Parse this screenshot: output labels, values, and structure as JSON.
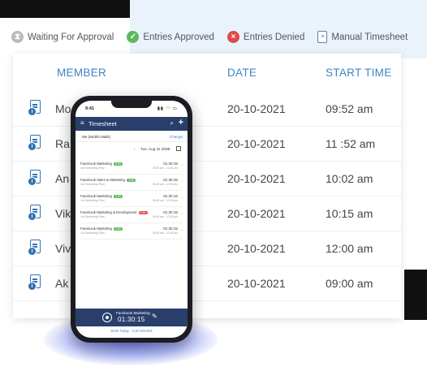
{
  "legend": [
    {
      "label": "Waiting For Approval",
      "icon": "hourglass-icon"
    },
    {
      "label": "Entries Approved",
      "icon": "check-icon"
    },
    {
      "label": "Entries Denied",
      "icon": "x-icon"
    },
    {
      "label": "Manual Timesheet",
      "icon": "document-icon"
    }
  ],
  "table": {
    "headers": {
      "member": "MEMBER",
      "date": "DATE",
      "start": "START TIME"
    },
    "rows": [
      {
        "member": "Mo",
        "date": "20-10-2021",
        "start": "09:52 am"
      },
      {
        "member": "Ra",
        "date": "20-10-2021",
        "start": "11 :52 am"
      },
      {
        "member": "An",
        "date": "20-10-2021",
        "start": "10:02 am"
      },
      {
        "member": "Vik",
        "date": "20-10-2021",
        "start": "10:15 am"
      },
      {
        "member": "Viv",
        "date": "20-10-2021",
        "start": "12:00 am"
      },
      {
        "member": "Ak",
        "date": "20-10-2021",
        "start": "09:00 am"
      }
    ]
  },
  "phone": {
    "status_time": "9:41",
    "app_title": "Timesheet",
    "user_name": "Me (Mobbi Malik)",
    "change_label": "Change",
    "date_label": "Tue, Aug 31 2020",
    "entries": [
      {
        "name": "Facebook Marketing",
        "tag": "4.5h",
        "tag_color": "#5cb85c",
        "sub": "1st Marketing Plan",
        "duration": "01:30:15",
        "range": "09:45 am - 10:30 am"
      },
      {
        "name": "Facebook Sales & Marketing",
        "tag": "4.5h",
        "tag_color": "#5cb85c",
        "sub": "1st Marketing Plan",
        "duration": "01:30:15",
        "range": "09:45 am - 10:30 am"
      },
      {
        "name": "Facebook Marketing",
        "tag": "4.5h",
        "tag_color": "#5cb85c",
        "sub": "1st Marketing Plan",
        "duration": "01:30:15",
        "range": "09:45 am - 10:30 am"
      },
      {
        "name": "Facebook Marketing & Development",
        "tag": "4.5h",
        "tag_color": "#e04b4b",
        "sub": "1st Marketing Plan",
        "duration": "01:30:15",
        "range": "09:45 am - 10:30 am"
      },
      {
        "name": "Facebook Marketing",
        "tag": "4.5h",
        "tag_color": "#5cb85c",
        "sub": "1st Marketing Plan",
        "duration": "01:30:15",
        "range": "09:45 am - 10:30 am"
      }
    ],
    "timer": {
      "name": "Facebook Marketing",
      "time": "01:30:15"
    },
    "work_today": "Work Today : 2:30 HOURS"
  }
}
